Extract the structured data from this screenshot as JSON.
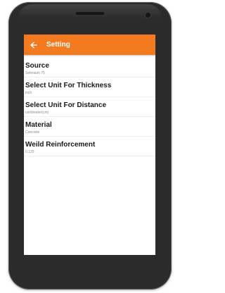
{
  "app_bar": {
    "title": "Setting",
    "back_icon": "arrow-left-icon",
    "color": "#f47a20"
  },
  "settings": [
    {
      "label": "Source",
      "value": "Selenium 75"
    },
    {
      "label": "Select Unit For Thickness",
      "value": "inch"
    },
    {
      "label": "Select Unit For Distance",
      "value": "centimeter(cm)"
    },
    {
      "label": "Material",
      "value": "Concrete"
    },
    {
      "label": "Weild Reinforcement",
      "value": "0.125"
    }
  ]
}
